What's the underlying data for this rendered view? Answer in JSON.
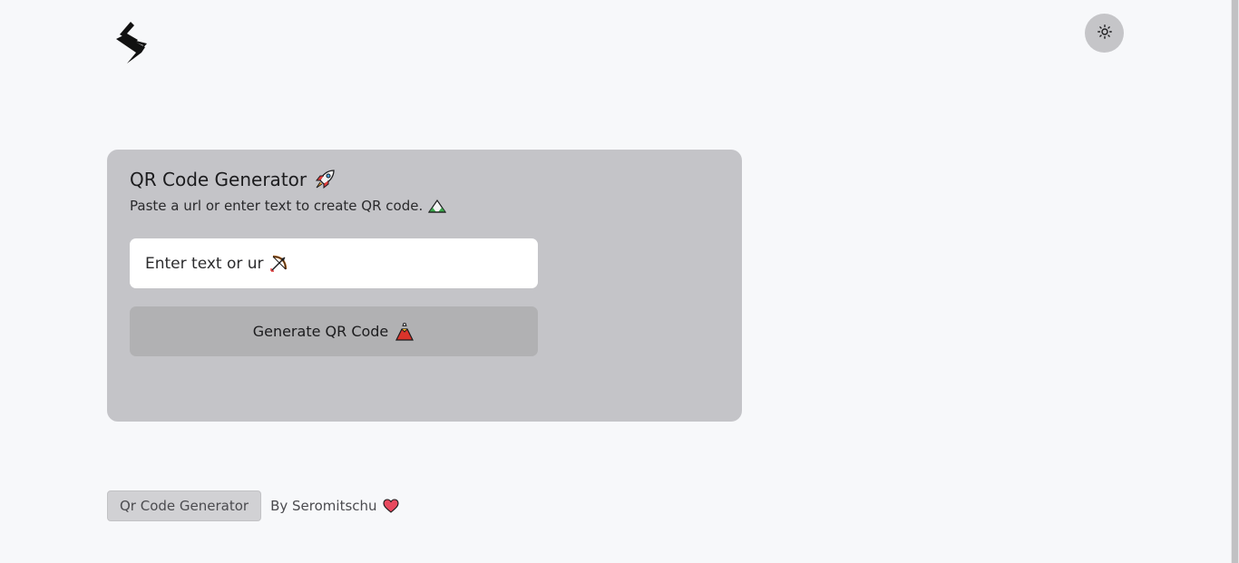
{
  "header": {
    "logo_icon": "lightning-s-logo",
    "theme_toggle_icon": "sun-icon"
  },
  "card": {
    "title": "QR Code Generator",
    "title_icon": "rocket-emoji",
    "subtitle": "Paste a url or enter text to create QR code.",
    "subtitle_icon": "mountain-emoji",
    "input_placeholder": "Enter text or url",
    "input_icon": "bow-and-arrow-emoji",
    "input_value": "",
    "button_label": "Generate QR Code",
    "button_icon": "volcano-emoji"
  },
  "footer": {
    "badge": "Qr Code Generator",
    "credit": "By Seromitschu",
    "credit_icon": "heart-emoji"
  },
  "colors": {
    "background": "#f7f8fa",
    "card": "#c4c4c8",
    "button": "#b1b1b3",
    "toggle": "#c5c5c8",
    "heart": "#e84a5f"
  }
}
